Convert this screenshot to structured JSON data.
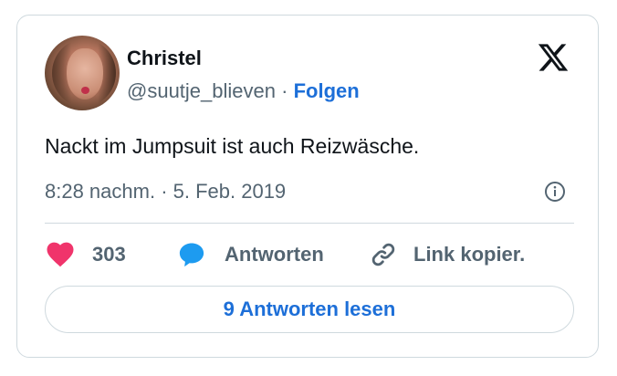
{
  "author": {
    "name": "Christel",
    "handle": "@suutje_blieven",
    "separator": "·",
    "follow_label": "Folgen"
  },
  "tweet": {
    "text": "Nackt im Jumpsuit ist auch Reizwäsche.",
    "time": "8:28 nachm. · 5. Feb. 2019"
  },
  "actions": {
    "like_count": "303",
    "reply_label": "Antworten",
    "copy_link_label": "Link kopier."
  },
  "footer": {
    "read_replies_label": "9 Antworten lesen"
  },
  "colors": {
    "accent": "#1d6fd8",
    "heart": "#f0346b",
    "reply_bubble": "#1d9bf0",
    "muted": "#536471",
    "border": "#cfd9de"
  },
  "icons": [
    "x-logo-icon",
    "info-icon",
    "heart-icon",
    "speech-bubble-icon",
    "link-icon"
  ]
}
